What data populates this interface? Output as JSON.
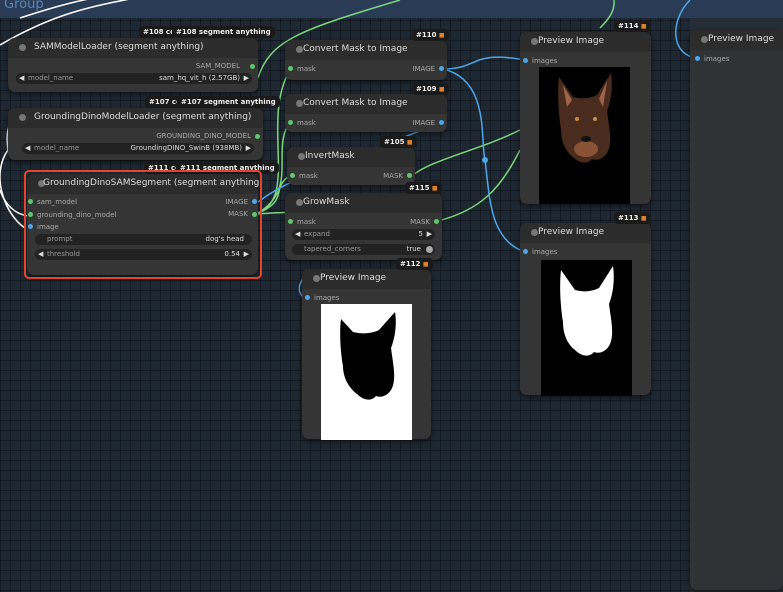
{
  "group": {
    "title": "Group"
  },
  "nodes": {
    "sam_loader": {
      "title": "SAMModelLoader (segment anything)",
      "badge_a": "#108 con",
      "badge_b": "#108 segment anything",
      "output": "SAM_MODEL",
      "widget_label": "model_name",
      "widget_value": "sam_hq_vit_h (2.57GB)"
    },
    "gdino_loader": {
      "title": "GroundingDinoModelLoader (segment anything)",
      "badge_a": "#107 con",
      "badge_b": "#107 segment anything",
      "output": "GROUNDING_DINO_MODEL",
      "widget_label": "model_name",
      "widget_value": "GroundingDINO_SwinB (938MB)"
    },
    "gdino_sam": {
      "title": "GroundingDinoSAMSegment (segment anything)",
      "badge_a": "#111 con",
      "badge_b": "#111 segment anything",
      "inputs": [
        "sam_model",
        "grounding_dino_model",
        "image"
      ],
      "outputs": [
        "IMAGE",
        "MASK"
      ],
      "prompt_label": "prompt",
      "prompt_value": "dog's head",
      "threshold_label": "threshold",
      "threshold_value": "0.54"
    },
    "convert_110": {
      "title": "Convert Mask to Image",
      "badge": "#110",
      "input": "mask",
      "output": "IMAGE"
    },
    "convert_109": {
      "title": "Convert Mask to Image",
      "badge": "#109",
      "input": "mask",
      "output": "IMAGE"
    },
    "invert_105": {
      "title": "InvertMask",
      "badge": "#105",
      "input": "mask",
      "output": "MASK"
    },
    "grow_115": {
      "title": "GrowMask",
      "badge": "#115",
      "input": "mask",
      "output": "MASK",
      "expand_label": "expand",
      "expand_value": "5",
      "tapered_label": "tapered_corners",
      "tapered_value": "true"
    },
    "preview_112": {
      "title": "Preview Image",
      "badge": "#112",
      "input": "images"
    },
    "preview_114": {
      "title": "Preview Image",
      "badge": "#114",
      "input": "images"
    },
    "preview_113": {
      "title": "Preview Image",
      "badge": "#113",
      "input": "images"
    },
    "preview_right": {
      "title": "Preview Image",
      "input": "images"
    }
  },
  "colors": {
    "canvas": "#1e2833",
    "node_body": "#353535",
    "node_title": "#2c2c2c",
    "wire_green": "#7bd67b",
    "wire_blue": "#4da6e8",
    "highlight": "#e0462d",
    "badge_icon": "#e0822a"
  },
  "icons": {
    "left_arrow": "◀",
    "right_arrow": "▶",
    "badge_icon": "fox-icon"
  }
}
